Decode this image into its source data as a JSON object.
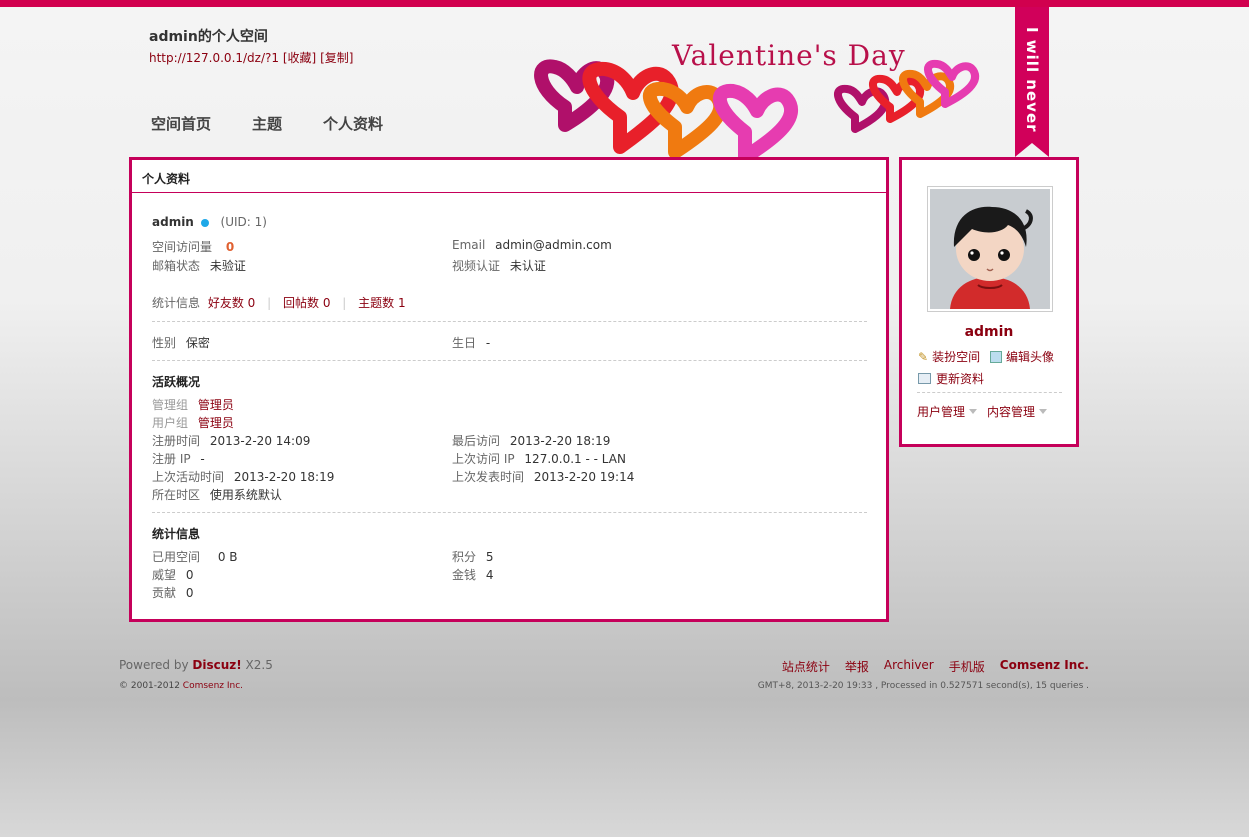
{
  "header": {
    "space_title": "admin的个人空间",
    "space_url": "http://127.0.0.1/dz/?1",
    "favorite_label": "[收藏]",
    "copy_label": "[复制]",
    "banner_text": "Valentine's Day",
    "ribbon_text": "I will never"
  },
  "nav": {
    "items": [
      "空间首页",
      "主题",
      "个人资料"
    ]
  },
  "profile": {
    "panel_title": "个人资料",
    "username": "admin",
    "uid": "(UID: 1)",
    "visits_label": "空间访问量",
    "visits_value": "0",
    "email_label": "Email",
    "email_value": "admin@admin.com",
    "email_status_label": "邮箱状态",
    "email_status_value": "未验证",
    "video_label": "视频认证",
    "video_value": "未认证",
    "stats_label": "统计信息",
    "friends": "好友数 0",
    "replies": "回帖数 0",
    "threads": "主题数 1",
    "gender_label": "性别",
    "gender_value": "保密",
    "birthday_label": "生日",
    "birthday_value": "-",
    "activity_title": "活跃概况",
    "admin_group_label": "管理组",
    "admin_group_value": "管理员",
    "user_group_label": "用户组",
    "user_group_value": "管理员",
    "reg_time_label": "注册时间",
    "reg_time_value": "2013-2-20 14:09",
    "last_visit_label": "最后访问",
    "last_visit_value": "2013-2-20 18:19",
    "reg_ip_label": "注册 IP",
    "reg_ip_value": "-",
    "last_ip_label": "上次访问 IP",
    "last_ip_value": "127.0.0.1 - - LAN",
    "last_active_label": "上次活动时间",
    "last_active_value": "2013-2-20 18:19",
    "last_post_label": "上次发表时间",
    "last_post_value": "2013-2-20 19:14",
    "timezone_label": "所在时区",
    "timezone_value": "使用系统默认",
    "stat_title": "统计信息",
    "used_space_label": "已用空间",
    "used_space_value": "0 B",
    "points_label": "积分",
    "points_value": "5",
    "prestige_label": "威望",
    "prestige_value": "0",
    "money_label": "金钱",
    "money_value": "4",
    "contribution_label": "贡献",
    "contribution_value": "0"
  },
  "sidebar": {
    "name": "admin",
    "decorate": "装扮空间",
    "edit_avatar": "编辑头像",
    "update_profile": "更新资料",
    "user_manage": "用户管理",
    "content_manage": "内容管理"
  },
  "footer": {
    "powered_prefix": "Powered by ",
    "powered_brand": "Discuz!",
    "powered_version": " X2.5",
    "copyright_prefix": "© 2001-2012 ",
    "copyright_company": "Comsenz Inc.",
    "links": [
      "站点统计",
      "举报",
      "Archiver",
      "手机版",
      "Comsenz Inc."
    ],
    "info": "GMT+8, 2013-2-20 19:33 , Processed in 0.527571 second(s), 15 queries ."
  },
  "colors": {
    "accent": "#c5005a",
    "link": "#8b0010"
  }
}
